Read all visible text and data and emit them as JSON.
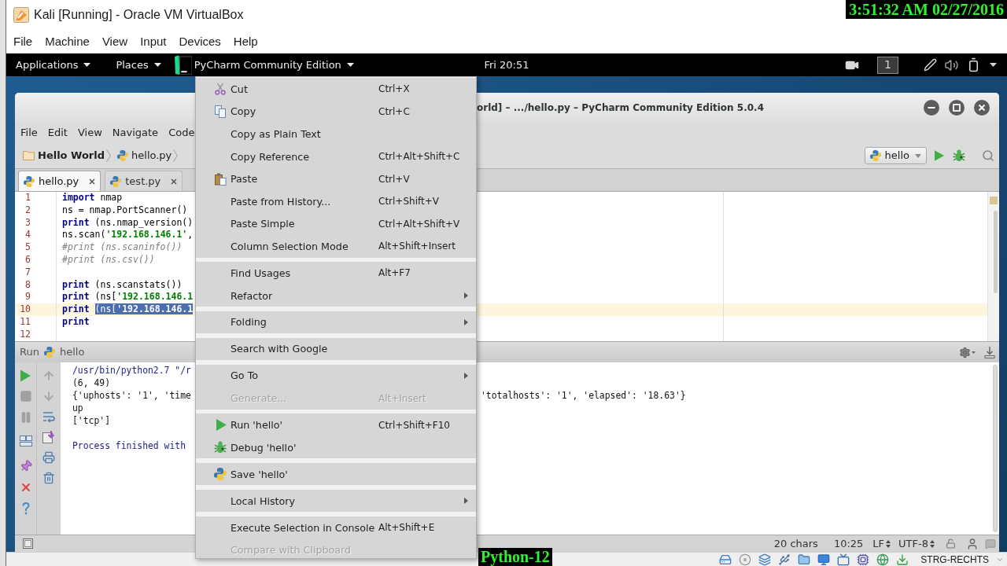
{
  "vbox": {
    "title": "Kali [Running] - Oracle VM VirtualBox",
    "menu": [
      "File",
      "Machine",
      "View",
      "Input",
      "Devices",
      "Help"
    ],
    "status_text": "STRG-RECHTS"
  },
  "overlays": {
    "timestamp": "3:51:32 AM 02/27/2016",
    "lesson": "Python-12"
  },
  "top_panel": {
    "menus": [
      "Applications",
      "Places"
    ],
    "app_menu": "PyCharm Community Edition",
    "clock": "Fri 20:51",
    "workspace": "1"
  },
  "ide": {
    "title": "orld] – .../hello.py – PyCharm Community Edition 5.0.4",
    "menu": [
      "File",
      "Edit",
      "View",
      "Navigate",
      "Code"
    ],
    "breadcrumbs": [
      {
        "label": "Hello World",
        "kind": "project"
      },
      {
        "label": "hello.py",
        "kind": "file"
      }
    ],
    "run_config": "hello",
    "tabs": [
      {
        "label": "hello.py",
        "selected": true
      },
      {
        "label": "test.py",
        "selected": false
      }
    ],
    "editor_lines": [
      {
        "number": "1",
        "current": false,
        "tokens": [
          {
            "text": "import",
            "kind": "keyword",
            "selected": false
          },
          {
            "text": " nmap",
            "kind": "plain",
            "selected": false
          }
        ]
      },
      {
        "number": "2",
        "current": false,
        "tokens": [
          {
            "text": "ns = nmap.PortScanner()",
            "kind": "plain",
            "selected": false
          }
        ]
      },
      {
        "number": "3",
        "current": false,
        "tokens": [
          {
            "text": "print",
            "kind": "keyword",
            "selected": false
          },
          {
            "text": " (ns.nmap_version()",
            "kind": "plain",
            "selected": false
          }
        ]
      },
      {
        "number": "4",
        "current": false,
        "tokens": [
          {
            "text": "ns.scan(",
            "kind": "plain",
            "selected": false
          },
          {
            "text": "'192.168.146.1'",
            "kind": "string",
            "selected": false
          },
          {
            "text": ",",
            "kind": "plain",
            "selected": false
          }
        ]
      },
      {
        "number": "5",
        "current": false,
        "tokens": [
          {
            "text": "#print (ns.scaninfo())",
            "kind": "comment",
            "selected": false
          }
        ]
      },
      {
        "number": "6",
        "current": false,
        "tokens": [
          {
            "text": "#print (ns.csv())",
            "kind": "comment",
            "selected": false
          }
        ]
      },
      {
        "number": "7",
        "current": false
      },
      {
        "number": "8",
        "current": false,
        "tokens": [
          {
            "text": "print",
            "kind": "keyword",
            "selected": false
          },
          {
            "text": " (ns.scanstats())",
            "kind": "plain",
            "selected": false
          }
        ]
      },
      {
        "number": "9",
        "current": false,
        "tokens": [
          {
            "text": "print",
            "kind": "keyword",
            "selected": false
          },
          {
            "text": " (ns[",
            "kind": "plain",
            "selected": false
          },
          {
            "text": "'192.168.146.1",
            "kind": "string",
            "selected": false
          }
        ]
      },
      {
        "number": "10",
        "current": true,
        "tokens": [
          {
            "text": "print ",
            "kind": "keyword",
            "selected": false
          },
          {
            "text": "(ns[",
            "kind": "plain",
            "selected": true
          },
          {
            "text": "'192.168.146.1",
            "kind": "string",
            "selected": true
          }
        ]
      },
      {
        "number": "11",
        "current": false,
        "tokens": [
          {
            "text": "print",
            "kind": "keyword",
            "selected": false
          }
        ]
      },
      {
        "number": "12",
        "current": false
      }
    ],
    "run_panel": {
      "title": "Run",
      "config": "hello",
      "console": [
        {
          "kind": "command",
          "text": "/usr/bin/python2.7 \"/r"
        },
        {
          "kind": "output",
          "text": "(6, 49)"
        },
        {
          "kind": "output",
          "text": "{'uphosts': '1', 'time",
          "text_right": "'totalhosts': '1', 'elapsed': '18.63'}"
        },
        {
          "kind": "output",
          "text": "up"
        },
        {
          "kind": "output",
          "text": "['tcp']"
        },
        {
          "kind": "blank"
        },
        {
          "kind": "info",
          "text": "Process finished with"
        }
      ]
    },
    "status_bar": {
      "selection": "20 chars",
      "caret": "10:25",
      "line_separator": "LF",
      "encoding": "UTF-8"
    }
  },
  "context_menu": {
    "groups": [
      [
        {
          "label": "Cut",
          "shortcut": "Ctrl+X",
          "submenu": false,
          "disabled": false
        },
        {
          "label": "Copy",
          "shortcut": "Ctrl+C",
          "submenu": false,
          "disabled": false
        },
        {
          "label": "Copy as Plain Text",
          "submenu": false,
          "disabled": false
        },
        {
          "label": "Copy Reference",
          "shortcut": "Ctrl+Alt+Shift+C",
          "submenu": false,
          "disabled": false
        },
        {
          "label": "Paste",
          "shortcut": "Ctrl+V",
          "submenu": false,
          "disabled": false
        },
        {
          "label": "Paste from History...",
          "shortcut": "Ctrl+Shift+V",
          "submenu": false,
          "disabled": false
        },
        {
          "label": "Paste Simple",
          "shortcut": "Ctrl+Alt+Shift+V",
          "submenu": false,
          "disabled": false
        },
        {
          "label": "Column Selection Mode",
          "shortcut": "Alt+Shift+Insert",
          "submenu": false,
          "disabled": false
        }
      ],
      [
        {
          "label": "Find Usages",
          "shortcut": "Alt+F7",
          "submenu": false,
          "disabled": false
        },
        {
          "label": "Refactor",
          "submenu": true,
          "disabled": false
        }
      ],
      [
        {
          "label": "Folding",
          "submenu": true,
          "disabled": false
        }
      ],
      [
        {
          "label": "Search with Google",
          "submenu": false,
          "disabled": false
        }
      ],
      [
        {
          "label": "Go To",
          "submenu": true,
          "disabled": false
        },
        {
          "label": "Generate...",
          "shortcut": "Alt+Insert",
          "submenu": false,
          "disabled": true
        }
      ],
      [
        {
          "label": "Run 'hello'",
          "shortcut": "Ctrl+Shift+F10",
          "submenu": false,
          "disabled": false
        },
        {
          "label": "Debug 'hello'",
          "submenu": false,
          "disabled": false
        }
      ],
      [
        {
          "label": "Save 'hello'",
          "submenu": false,
          "disabled": false
        }
      ],
      [
        {
          "label": "Local History",
          "submenu": true,
          "disabled": false
        }
      ],
      [
        {
          "label": "Execute Selection in Console",
          "shortcut": "Alt+Shift+E",
          "submenu": false,
          "disabled": false
        },
        {
          "label": "Compare with Clipboard",
          "submenu": false,
          "disabled": true
        }
      ]
    ]
  }
}
